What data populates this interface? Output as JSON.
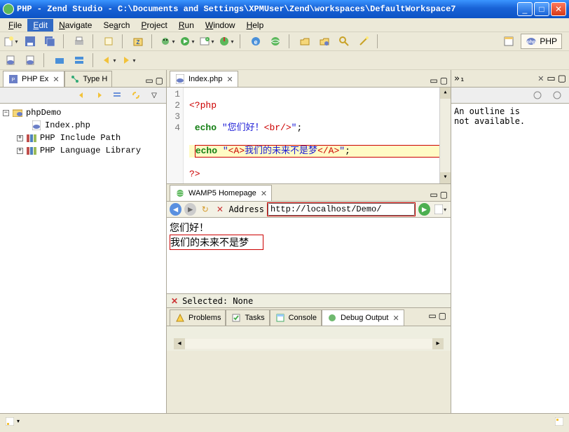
{
  "window": {
    "title": "PHP - Zend Studio - C:\\Documents and Settings\\XPMUser\\Zend\\workspaces\\DefaultWorkspace7"
  },
  "menu": {
    "items": [
      {
        "id": "file",
        "label": "File",
        "accel": "F"
      },
      {
        "id": "edit",
        "label": "Edit",
        "accel": "E",
        "selected": true
      },
      {
        "id": "navigate",
        "label": "Navigate",
        "accel": "N"
      },
      {
        "id": "search",
        "label": "Search",
        "accel": "a"
      },
      {
        "id": "project",
        "label": "Project",
        "accel": "P"
      },
      {
        "id": "run",
        "label": "Run",
        "accel": "R"
      },
      {
        "id": "window",
        "label": "Window",
        "accel": "W"
      },
      {
        "id": "help",
        "label": "Help",
        "accel": "H"
      }
    ]
  },
  "perspective": {
    "label": "PHP"
  },
  "left_view": {
    "tab1": "PHP Ex",
    "tab2": "Type H",
    "project": "phpDemo",
    "nodes": [
      {
        "id": "index",
        "label": "Index.php",
        "icon": "php-file-icon"
      },
      {
        "id": "include",
        "label": "PHP Include Path",
        "icon": "books-icon",
        "expandable": true
      },
      {
        "id": "library",
        "label": "PHP Language Library",
        "icon": "books-icon",
        "expandable": true
      }
    ]
  },
  "editor": {
    "tab": "Index.php",
    "linenos": [
      "1",
      "2",
      "3",
      "4"
    ],
    "lines": {
      "l1_open": "<?php",
      "l2_kw": "echo",
      "l2_q1": " \"",
      "l2_cn": "您们好！",
      "l2_tag": "<br/>",
      "l2_q2": "\"",
      "l2_semi": ";",
      "l3_kw": "echo",
      "l3_q1": " \"",
      "l3_tagA": "<A>",
      "l3_cn": "我们的未来不是梦",
      "l3_tagAc": "</A>",
      "l3_q2": "\"",
      "l3_semi": ";",
      "l4_close": "?>"
    }
  },
  "browser": {
    "tab": "WAMP5 Homepage",
    "addressLabel": "Address",
    "url": "http://localhost/Demo/",
    "page_line1": "您们好！",
    "page_line2": "我们的未来不是梦",
    "selected": "Selected: None"
  },
  "bottom": {
    "tabs": [
      "Problems",
      "Tasks",
      "Console",
      "Debug Output"
    ]
  },
  "outline": {
    "indicator": "»₁",
    "msg_line1": "An outline is",
    "msg_line2": "not available."
  },
  "tb1": [
    "new-dd",
    "save",
    "save-all",
    "sep",
    "print",
    "sep",
    "build",
    "sep",
    "zend-project",
    "sep",
    "debug-dd",
    "run-dd",
    "ext-dd",
    "profile-dd",
    "sep",
    "ie-icon",
    "globe-icon",
    "sep",
    "open",
    "open-type",
    "search-icon",
    "wand",
    "sep"
  ],
  "tb2": [
    "new-php",
    "open-php",
    "sep",
    "nav-blue1",
    "nav-blue2",
    "sep",
    "back-dd",
    "forward-dd"
  ]
}
